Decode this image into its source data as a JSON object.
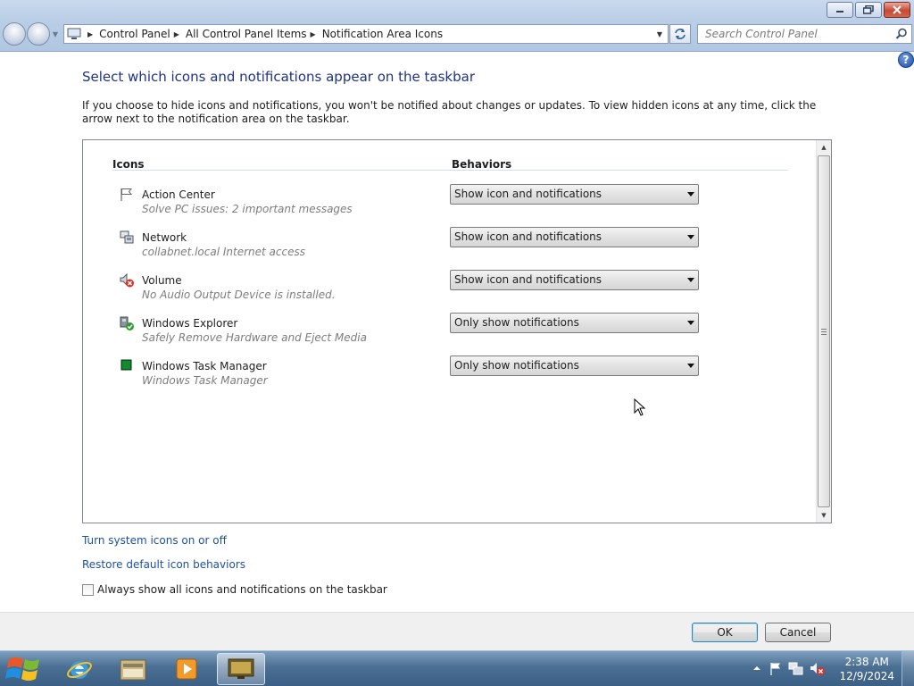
{
  "address_bar": {
    "breadcrumbs": [
      "Control Panel",
      "All Control Panel Items",
      "Notification Area Icons"
    ],
    "search_placeholder": "Search Control Panel"
  },
  "page": {
    "title": "Select which icons and notifications appear on the taskbar",
    "intro": "If you choose to hide icons and notifications, you won't be notified about changes or updates. To view hidden icons at any time, click the arrow next to the notification area on the taskbar."
  },
  "list": {
    "col_icons": "Icons",
    "col_behaviors": "Behaviors",
    "rows": [
      {
        "name": "Action Center",
        "desc": "Solve PC issues: 2 important messages",
        "behavior": "Show icon and notifications",
        "icon": "flag-icon"
      },
      {
        "name": "Network",
        "desc": "collabnet.local Internet access",
        "behavior": "Show icon and notifications",
        "icon": "network-icon"
      },
      {
        "name": "Volume",
        "desc": "No Audio Output Device is installed.",
        "behavior": "Show icon and notifications",
        "icon": "volume-muted-icon"
      },
      {
        "name": "Windows Explorer",
        "desc": "Safely Remove Hardware and Eject Media",
        "behavior": "Only show notifications",
        "icon": "safely-remove-icon"
      },
      {
        "name": "Windows Task Manager",
        "desc": "Windows Task Manager",
        "behavior": "Only show notifications",
        "icon": "task-manager-icon"
      }
    ]
  },
  "links": {
    "system_icons": "Turn system icons on or off",
    "restore_defaults": "Restore default icon behaviors"
  },
  "checkbox": {
    "label": "Always show all icons and notifications on the taskbar",
    "checked": false
  },
  "buttons": {
    "ok": "OK",
    "cancel": "Cancel"
  },
  "taskbar": {
    "time": "2:38 AM",
    "date": "12/9/2024"
  }
}
